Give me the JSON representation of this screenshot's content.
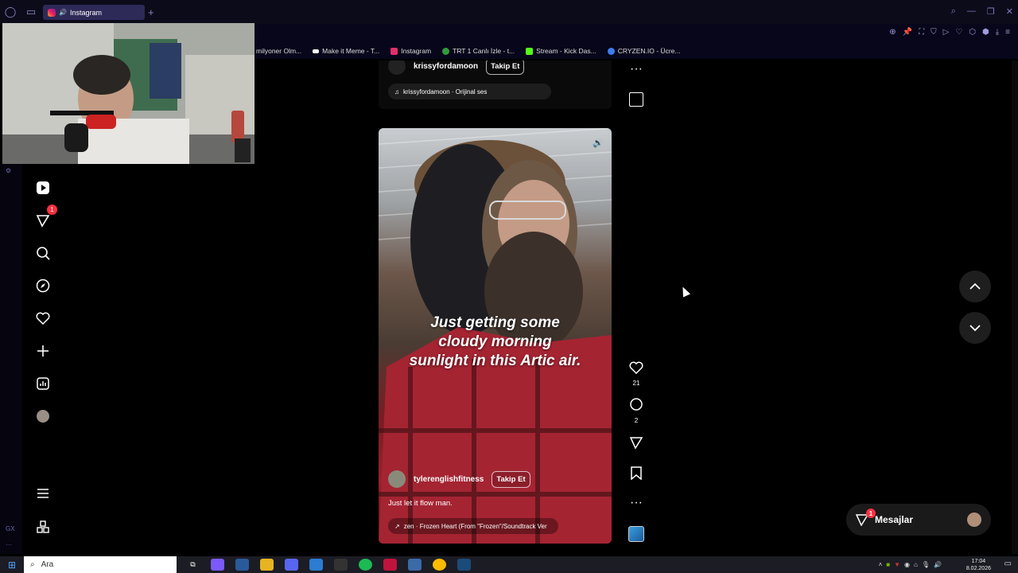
{
  "browser": {
    "tab_title": "Instagram",
    "new_tab_icon": "plus-icon",
    "bookmarks": [
      {
        "label": "milyoner Olm...",
        "color": "#0a0a20"
      },
      {
        "label": "Make it Meme - T...",
        "color": "#ffffff"
      },
      {
        "label": "Instagram",
        "color": "#e1306c"
      },
      {
        "label": "TRT 1 Canlı İzle - t...",
        "color": "#2e9c3c"
      },
      {
        "label": "Stream - Kick Das...",
        "color": "#53fc18"
      },
      {
        "label": "CRYZEN.IO - Ücre...",
        "color": "#3c7cf0"
      }
    ]
  },
  "sidebar": {
    "notification_count": "1",
    "items": [
      "reels-icon",
      "messages-icon",
      "search-icon",
      "explore-icon",
      "heart-icon",
      "create-icon",
      "dashboard-icon",
      "profile-avatar",
      "menu-icon",
      "apps-icon"
    ]
  },
  "previous_reel": {
    "username": "krissyfordamoon",
    "follow_label": "Takip Et",
    "audio": "krissyfordamoon · Orijinal ses"
  },
  "reel": {
    "caption_lines": [
      "Just getting some",
      "cloudy morning",
      "sunlight in this Artic air."
    ],
    "username": "tylerenglishfitness",
    "follow_label": "Takip Et",
    "description": "Just let it flow man.",
    "audio": "zen · Frozen Heart (From \"Frozen\"/Soundtrack Ver",
    "likes": "21",
    "comments": "2"
  },
  "messages": {
    "label": "Mesajlar",
    "badge": "1"
  },
  "taskbar": {
    "search_placeholder": "Ara",
    "time": "17:04",
    "date": "8.02.2026"
  },
  "colors": {
    "accent": "#ff3040",
    "browser_bg": "#0c0b1a",
    "tab_active": "#2e2a58"
  }
}
